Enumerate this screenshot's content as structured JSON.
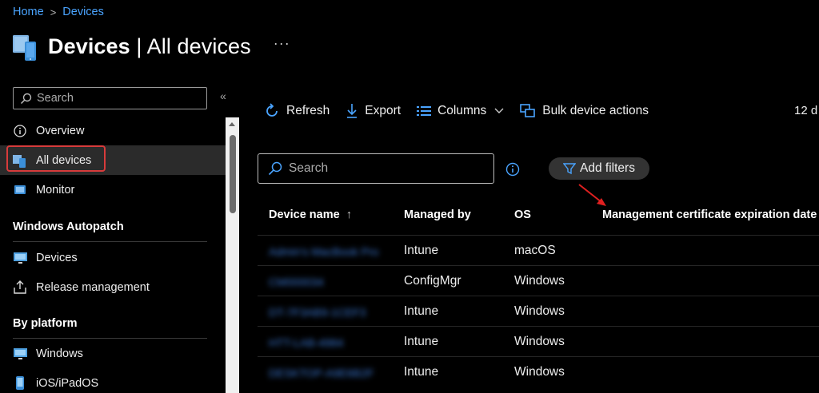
{
  "breadcrumb": {
    "home": "Home",
    "sep": ">",
    "current": "Devices"
  },
  "header": {
    "title_bold": "Devices",
    "title_rest": " | All devices",
    "more": "···"
  },
  "sidebar": {
    "search_placeholder": "Search",
    "collapse": "«",
    "items": [
      {
        "label": "Overview",
        "icon": "info-circle-icon"
      },
      {
        "label": "All devices",
        "icon": "devices-icon",
        "active": true
      },
      {
        "label": "Monitor",
        "icon": "monitor-icon"
      }
    ],
    "sections": [
      {
        "title": "Windows Autopatch",
        "items": [
          {
            "label": "Devices",
            "icon": "desktop-icon"
          },
          {
            "label": "Release management",
            "icon": "upload-icon"
          }
        ]
      },
      {
        "title": "By platform",
        "items": [
          {
            "label": "Windows",
            "icon": "windows-icon"
          },
          {
            "label": "iOS/iPadOS",
            "icon": "phone-icon"
          }
        ]
      }
    ]
  },
  "toolbar": {
    "refresh": "Refresh",
    "export": "Export",
    "columns": "Columns",
    "bulk": "Bulk device actions",
    "count": "12 d"
  },
  "filters": {
    "search_placeholder": "Search",
    "add_filters": "Add filters"
  },
  "table": {
    "headers": [
      "Device name",
      "Managed by",
      "OS",
      "Management certificate expiration date"
    ],
    "sort_indicator": "↑",
    "rows": [
      {
        "name": "Admin's MacBook Pro",
        "managed_by": "Intune",
        "os": "macOS"
      },
      {
        "name": "CM000034",
        "managed_by": "ConfigMgr",
        "os": "Windows"
      },
      {
        "name": "DT-7F3AB9-1CEF3",
        "managed_by": "Intune",
        "os": "Windows"
      },
      {
        "name": "HTT-LAB-4984",
        "managed_by": "Intune",
        "os": "Windows"
      },
      {
        "name": "DESKTOP-A9E6B2F",
        "managed_by": "Intune",
        "os": "Windows"
      }
    ]
  },
  "colors": {
    "link": "#4aa4ff",
    "highlight": "#d83b3b",
    "background": "#000000"
  }
}
